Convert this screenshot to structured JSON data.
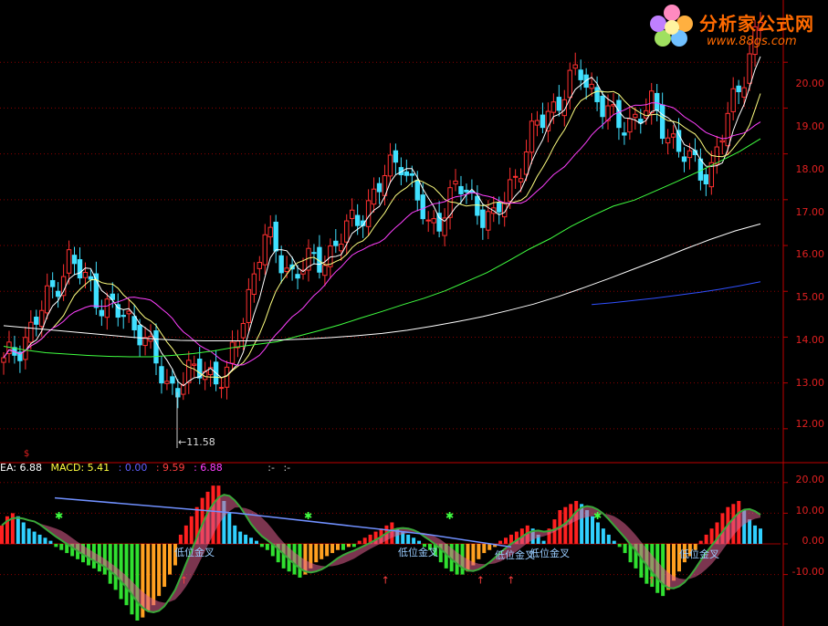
{
  "chart_data": [
    {
      "type": "candlestick",
      "price_axis": {
        "ticks": [
          "20.00",
          "19.00",
          "18.00",
          "17.00",
          "16.00",
          "15.00",
          "14.00",
          "13.00",
          "12.00"
        ],
        "ylim": [
          11.3,
          21.0
        ]
      },
      "min_label": "11.58",
      "colors": {
        "up": "#ff3030",
        "down": "#40e0ff",
        "ma5": "#ffffff",
        "ma10": "#ffff80",
        "ma20": "#ff40ff",
        "ma60": "#40ff40",
        "ma120": "#ffffff",
        "ma250": "#3050ff"
      },
      "ma60_values": [
        13.8,
        13.72,
        13.66,
        13.63,
        13.6,
        13.58,
        13.57,
        13.57,
        13.6,
        13.64,
        13.7,
        13.78,
        13.84,
        13.9,
        14.02,
        14.14,
        14.27,
        14.42,
        14.56,
        14.71,
        14.85,
        15.01,
        15.21,
        15.41,
        15.66,
        15.92,
        16.15,
        16.42,
        16.65,
        16.86,
        16.99,
        17.19,
        17.39,
        17.6,
        17.82,
        18.05,
        18.33
      ],
      "ma120_values": [
        14.25,
        14.2,
        14.15,
        14.1,
        14.05,
        14.0,
        13.96,
        13.93,
        13.92,
        13.92,
        13.92,
        13.94,
        13.96,
        13.99,
        14.03,
        14.08,
        14.15,
        14.24,
        14.34,
        14.45,
        14.58,
        14.72,
        14.89,
        15.08,
        15.28,
        15.49,
        15.7,
        15.92,
        16.13,
        16.32,
        16.47
      ],
      "ma250_values": [
        14.71,
        14.75,
        14.8,
        14.85,
        14.91,
        14.97,
        15.04,
        15.12,
        15.21
      ]
    },
    {
      "type": "bar",
      "indicator_header": {
        "ea": "EA: 6.88",
        "macd": "MACD: 5.41",
        "v1": ": 0.00",
        "v2": ": 9.59",
        "v3": ": 6.88",
        "v4": ":-",
        "v5": ":-"
      },
      "macd_axis": {
        "ticks": [
          "20.00",
          "10.00",
          "0.00",
          "-10.00"
        ],
        "ylim": [
          -25,
          25
        ]
      },
      "macd_values": [
        6,
        9,
        10,
        9,
        7,
        5,
        4,
        3,
        2,
        1,
        -1,
        -2,
        -3,
        -4,
        -5,
        -6,
        -7,
        -8,
        -9,
        -10,
        -13,
        -15,
        -18,
        -20,
        -23,
        -25,
        -24,
        -22,
        -20,
        -17,
        -14,
        -10,
        -7,
        3,
        6,
        9,
        12,
        15,
        17,
        19,
        19,
        14,
        10,
        6,
        4,
        3,
        2,
        1,
        -1,
        -2,
        -4,
        -6,
        -8,
        -9,
        -10,
        -11,
        -10,
        -8,
        -6,
        -5,
        -4,
        -3,
        -2,
        -2,
        -1,
        -1,
        1,
        2,
        3,
        4,
        5,
        6,
        7,
        5,
        4,
        3,
        2,
        1,
        -1,
        -2,
        -4,
        -6,
        -8,
        -9,
        -10,
        -10,
        -9,
        -7,
        -5,
        -3,
        -2,
        -1,
        1,
        2,
        3,
        4,
        5,
        6,
        5,
        3,
        1,
        5,
        8,
        11,
        12,
        13,
        14,
        13,
        11,
        9,
        7,
        5,
        3,
        1,
        -1,
        -3,
        -6,
        -8,
        -11,
        -13,
        -14,
        -16,
        -17,
        -15,
        -12,
        -9,
        -6,
        -4,
        -2,
        1,
        3,
        5,
        7,
        10,
        12,
        13,
        14,
        11,
        8,
        6,
        5
      ],
      "signal_text": "低位金叉",
      "signal_positions": [
        0.24,
        0.505,
        0.63,
        0.67,
        0.855
      ]
    }
  ],
  "logo": {
    "title": "分析家公式网",
    "url": "www.88gs.com"
  },
  "marker_dollar": "$"
}
